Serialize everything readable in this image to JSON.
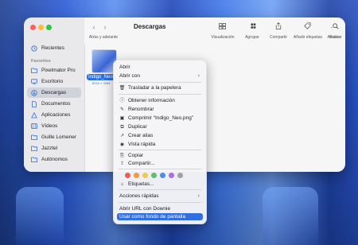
{
  "finder": {
    "title": "Descargas",
    "nav_label": "Atrás y adelante",
    "toolbar": {
      "view": "Visualización",
      "group": "Agrupar",
      "share": "Compartir",
      "tags": "Añadir etiquetas",
      "action": "Acción",
      "search": "Buscar"
    },
    "sidebar": {
      "recents": "Recientes",
      "favorites_header": "Favoritos",
      "items": [
        "Pixelmator Pro",
        "Escritorio",
        "Descargas",
        "Documentos",
        "Aplicaciones",
        "Vídeos",
        "Guille Lomener",
        "Jazztel",
        "Autónomos"
      ]
    },
    "file": {
      "name": "Indigo_Neo.",
      "dimensions": "6016 × 3384"
    }
  },
  "menu": {
    "open": "Abrir",
    "open_with": "Abrir con",
    "trash": "Trasladar a la papelera",
    "get_info": "Obtener información",
    "rename": "Renombrar",
    "compress": "Comprimir “Indigo_Neo.png”",
    "duplicate": "Duplicar",
    "alias": "Crear alias",
    "quick_look": "Vista rápida",
    "copy": "Copiar",
    "share": "Compartir...",
    "tags": "Etiquetas...",
    "quick_actions": "Acciones rápidas",
    "open_url": "Abrir URL con Downie",
    "set_wallpaper": "Usar como fondo de pantalla"
  },
  "colors": {
    "accent": "#2f6fe0",
    "tag_colors": [
      "#ef5b5b",
      "#f39a3d",
      "#f2c94c",
      "#5cc06a",
      "#4a8df0",
      "#a96ee0",
      "#a0a0a6"
    ]
  }
}
